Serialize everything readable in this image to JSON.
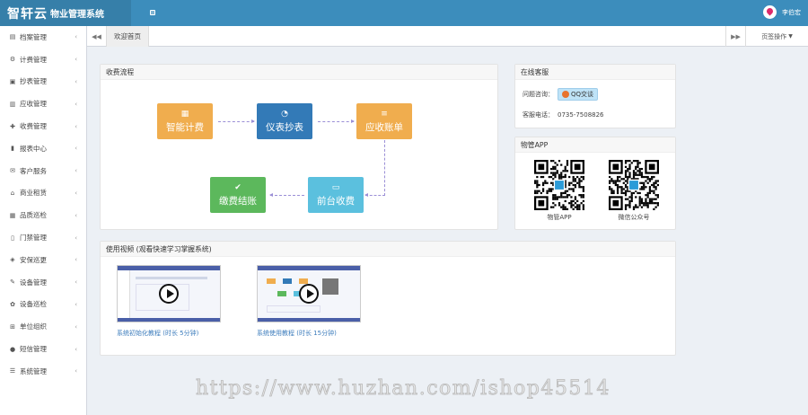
{
  "header": {
    "brand": "智轩云",
    "subtitle": "物业管理系统",
    "username": "李伯宏"
  },
  "sidebar": {
    "items": [
      {
        "label": "档案管理",
        "icon": "file-icon"
      },
      {
        "label": "计费管理",
        "icon": "cogs-icon"
      },
      {
        "label": "抄表管理",
        "icon": "meter-icon"
      },
      {
        "label": "应收管理",
        "icon": "inbox-icon"
      },
      {
        "label": "收费管理",
        "icon": "money-icon"
      },
      {
        "label": "报表中心",
        "icon": "chart-icon"
      },
      {
        "label": "客户服务",
        "icon": "chat-icon"
      },
      {
        "label": "商业租赁",
        "icon": "store-icon"
      },
      {
        "label": "品质巡检",
        "icon": "clipboard-icon"
      },
      {
        "label": "门禁管理",
        "icon": "door-icon"
      },
      {
        "label": "安保巡更",
        "icon": "shield-icon"
      },
      {
        "label": "设备管理",
        "icon": "wrench-icon"
      },
      {
        "label": "设备巡检",
        "icon": "leaf-icon"
      },
      {
        "label": "单位组织",
        "icon": "sitemap-icon"
      },
      {
        "label": "短信管理",
        "icon": "comment-icon"
      },
      {
        "label": "系统管理",
        "icon": "list-icon"
      }
    ]
  },
  "tabs": {
    "active": "欢迎首页",
    "operations": "页签操作"
  },
  "flow": {
    "title": "收费流程",
    "steps": {
      "billing": {
        "label": "智能计费",
        "icon": "calculator-icon",
        "color": "#f0ad4e"
      },
      "meter": {
        "label": "仪表抄表",
        "icon": "dashboard-icon",
        "color": "#337ab7"
      },
      "receivable": {
        "label": "应收账单",
        "icon": "list-icon",
        "color": "#f0ad4e"
      },
      "front": {
        "label": "前台收费",
        "icon": "credit-card-icon",
        "color": "#5bc0de"
      },
      "settle": {
        "label": "缴费结账",
        "icon": "check-icon",
        "color": "#5cb85c"
      }
    }
  },
  "online": {
    "title": "在线客服",
    "consult_label": "问题咨询：",
    "qq_label": "QQ交谈",
    "hotline_label": "客服电话：",
    "hotline": "0735-7508826"
  },
  "app": {
    "title": "物管APP",
    "qr1_caption": "物管APP",
    "qr2_caption": "微信公众号"
  },
  "videos": {
    "title": "使用视频 (观看快速学习掌握系统)",
    "items": [
      {
        "caption": "系统初始化教程 (时长 5分钟)"
      },
      {
        "caption": "系统使用教程 (时长 15分钟)"
      }
    ]
  },
  "watermark": "https://www.huzhan.com/ishop45514"
}
